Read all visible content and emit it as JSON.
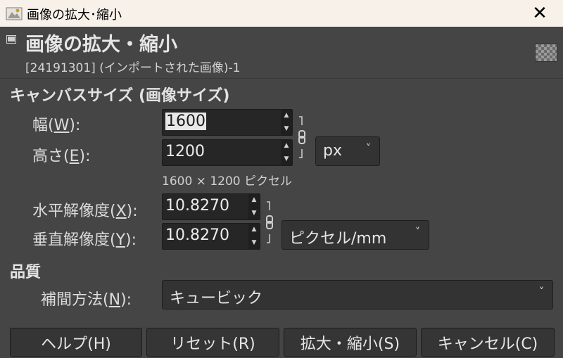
{
  "window": {
    "title": "画像の拡大･縮小",
    "close_glyph": "✕"
  },
  "header": {
    "title": "画像の拡大・縮小",
    "subtitle": "[24191301] (インポートされた画像)-1"
  },
  "canvas_size": {
    "section_title": "キャンバスサイズ (画像サイズ)",
    "width_label": "幅(",
    "width_mnemonic": "W",
    "width_label_end": "):",
    "width_value": "1600",
    "height_label": "高さ(",
    "height_mnemonic": "E",
    "height_label_end": "):",
    "height_value": "1200",
    "unit": "px",
    "pixel_info": "1600 × 1200 ピクセル"
  },
  "resolution": {
    "x_label": "水平解像度(",
    "x_mnemonic": "X",
    "x_label_end": "):",
    "x_value": "10.8270",
    "y_label": "垂直解像度(",
    "y_mnemonic": "Y",
    "y_label_end": "):",
    "y_value": "10.8270",
    "unit": "ピクセル/mm"
  },
  "quality": {
    "section_title": "品質",
    "interp_label": "補間方法(",
    "interp_mnemonic": "N",
    "interp_label_end": "):",
    "interp_value": "キュービック"
  },
  "buttons": {
    "help": "ヘルプ(H)",
    "reset": "リセット(R)",
    "scale": "拡大・縮小(S)",
    "cancel": "キャンセル(C)"
  },
  "icons": {
    "app": "gimp-icon",
    "chain": "chain-link-icon"
  }
}
